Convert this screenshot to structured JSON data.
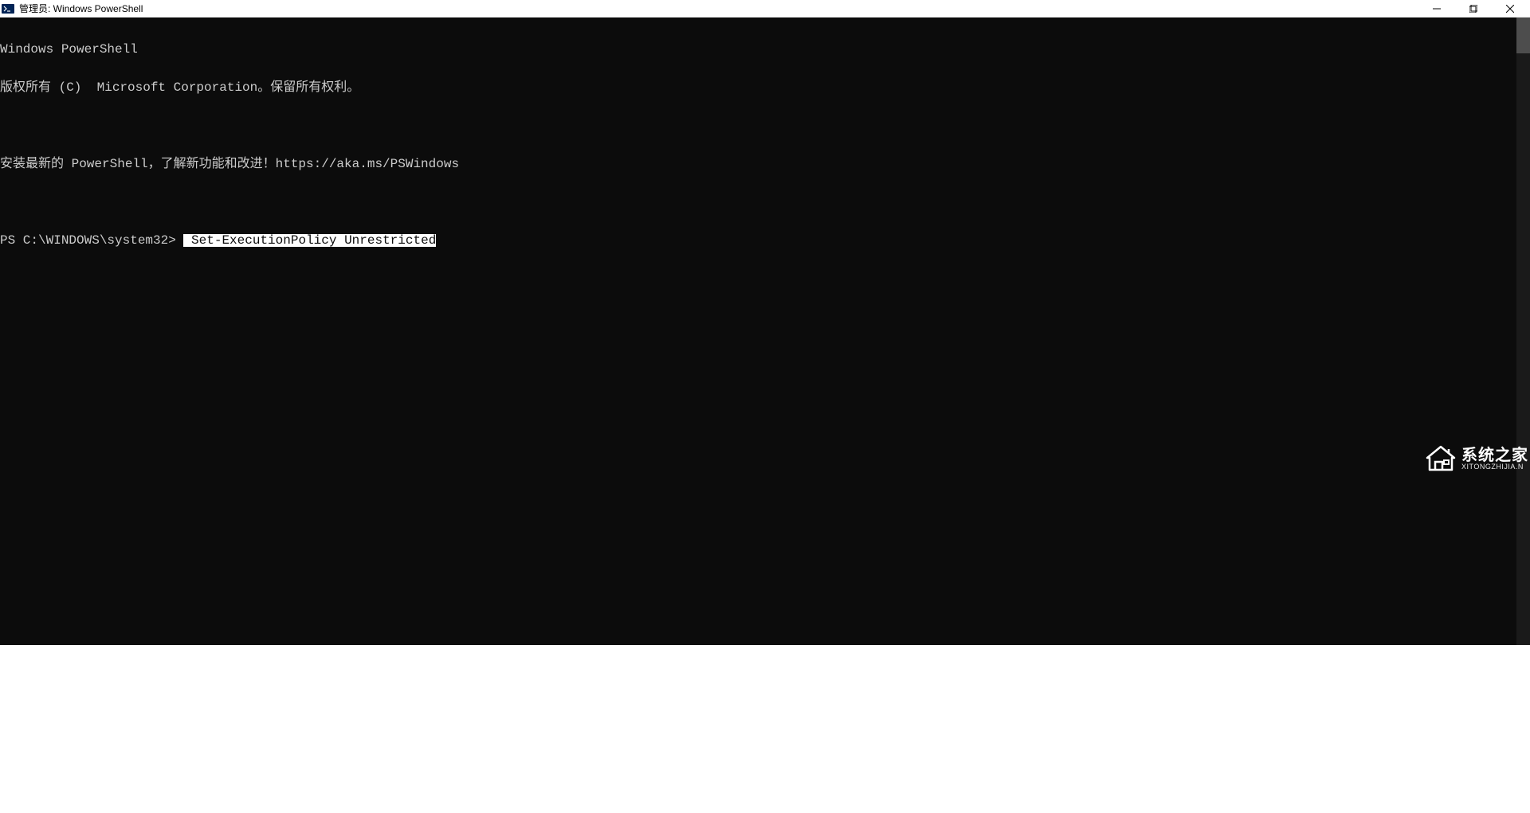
{
  "titlebar": {
    "title": "管理员: Windows PowerShell"
  },
  "terminal": {
    "line1": "Windows PowerShell",
    "line2": "版权所有 (C)  Microsoft Corporation。保留所有权利。",
    "line3": "",
    "line4": "安装最新的 PowerShell，了解新功能和改进！https://aka.ms/PSWindows",
    "line5": "",
    "prompt": "PS C:\\WINDOWS\\system32> ",
    "command": " Set-ExecutionPolicy Unrestricted"
  },
  "watermark": {
    "title": "系统之家",
    "sub": "XITONGZHIJIA.N"
  }
}
